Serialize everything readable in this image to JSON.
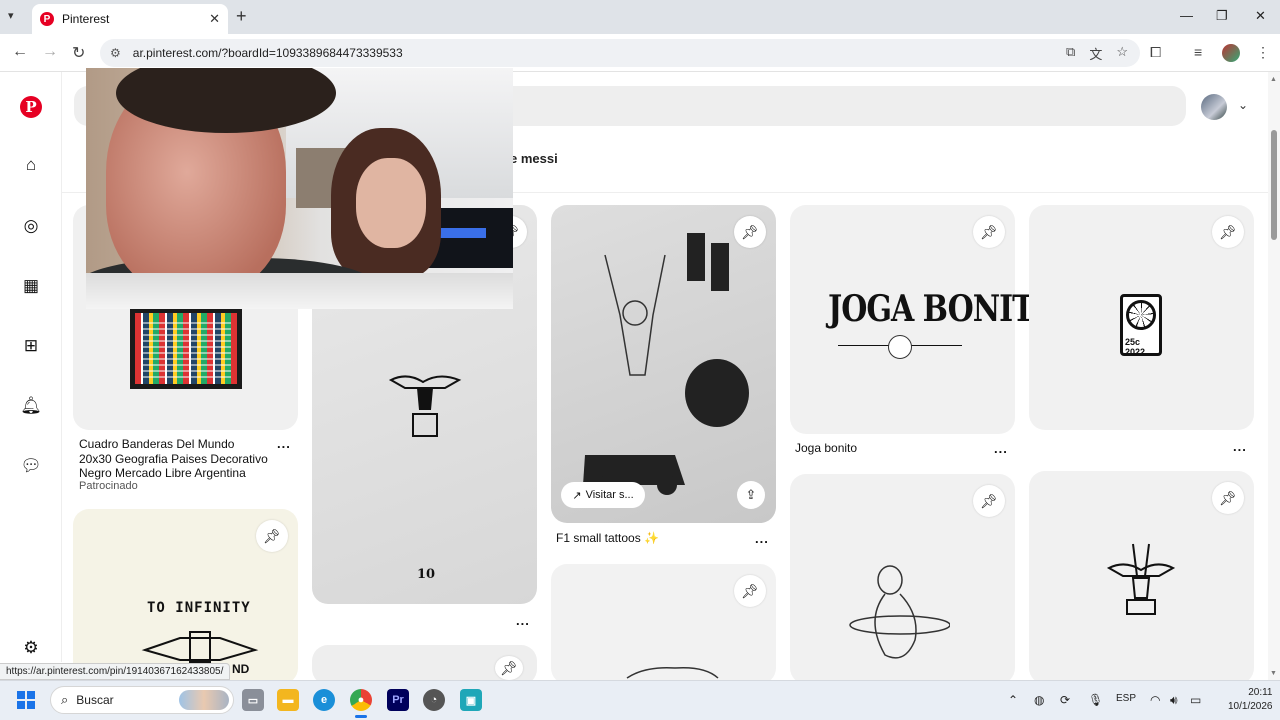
{
  "browser": {
    "tab_title": "Pinterest",
    "url": "ar.pinterest.com/?boardId=1093389684473339533",
    "status_url": "https://ar.pinterest.com/pin/19140367162433805/"
  },
  "pinterest": {
    "chip_text": "e messi",
    "pins": {
      "flags": {
        "title": "Cuadro Banderas Del Mundo 20x30 Geografia Paises Decorativo Negro Mercado Libre Argentina",
        "subtitle": "Patrocinado"
      },
      "tattoo_10": {
        "number": "10"
      },
      "f1": {
        "title": "F1 small tattoos ✨",
        "visit_label": "Visitar s..."
      },
      "joga": {
        "title": "Joga bonito",
        "logo_text": "JOGA BONITO"
      },
      "spidey": {
        "label": "25c 2022"
      },
      "infinity": {
        "text_top": "TO INFINITY",
        "text_bottom": "ND"
      }
    },
    "more_label": "..."
  },
  "taskbar": {
    "search_placeholder": "Buscar",
    "language": "ESP",
    "time": "20:11",
    "date": "10/1/2026"
  },
  "icons": {
    "save": "pushpin-icon",
    "share": "share-icon",
    "visit": "arrow-up-right-icon"
  }
}
